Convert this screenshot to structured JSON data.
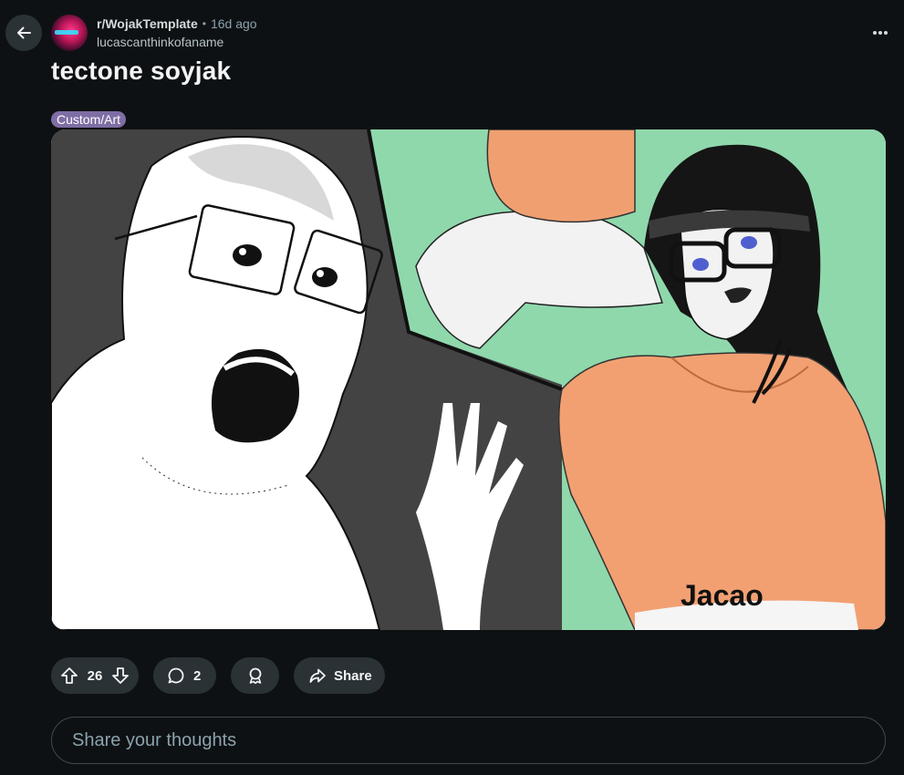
{
  "post": {
    "subreddit": "r/WojakTemplate",
    "separator": "•",
    "time_ago": "16d ago",
    "username": "lucascanthinkofaname",
    "title": "tectone soyjak",
    "flair": "Custom/Art",
    "image_caption_text": "Jacao"
  },
  "actions": {
    "upvotes": "26",
    "comments": "2",
    "share_label": "Share"
  },
  "comment_input": {
    "placeholder": "Share your thoughts"
  },
  "icons": {
    "back": "arrow-left-icon",
    "more": "ellipsis-icon",
    "upvote": "arrow-up-icon",
    "downvote": "arrow-down-icon",
    "comment": "speech-bubble-icon",
    "award": "award-icon",
    "share": "share-arrow-icon"
  },
  "colors": {
    "background": "#0e1113",
    "pill": "#2a3236",
    "flair": "#7f6ea5",
    "muted_text": "#8ba2ad"
  }
}
